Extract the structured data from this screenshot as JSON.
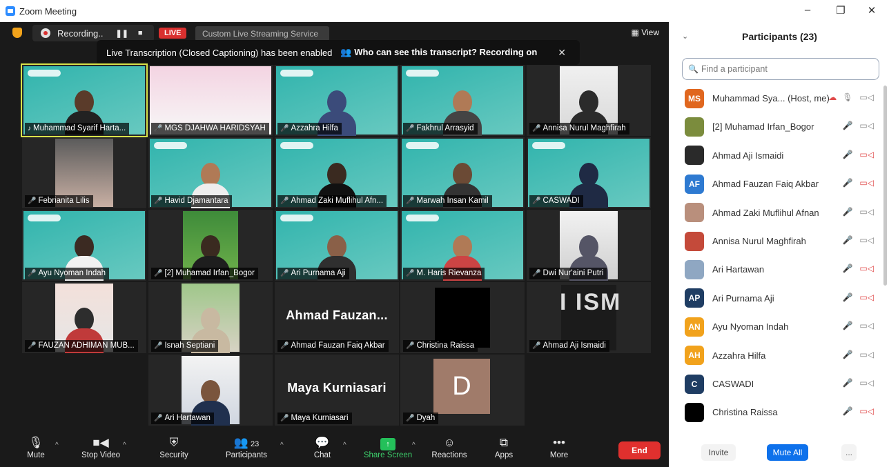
{
  "window": {
    "title": "Zoom Meeting"
  },
  "topbar": {
    "recording_label": "Recording..",
    "live_label": "LIVE",
    "stream_label": "Custom Live Streaming Service",
    "view_label": "View"
  },
  "caption_banner": {
    "text": "Live Transcription (Closed Captioning) has been enabled",
    "link": "Who can see this transcript? Recording on"
  },
  "tiles": [
    {
      "name": "Muhammad Syarif Harta..."
    },
    {
      "name": "MGS DJAHWA HARIDSYAH"
    },
    {
      "name": "Azzahra Hilfa"
    },
    {
      "name": "Fakhrul Arrasyid"
    },
    {
      "name": "Annisa Nurul Maghfirah"
    },
    {
      "name": "Febrianita Lilis"
    },
    {
      "name": "Havid Djamantara"
    },
    {
      "name": "Ahmad Zaki Muflihul Afn..."
    },
    {
      "name": "Marwah Insan Kamil"
    },
    {
      "name": "CASWADI"
    },
    {
      "name": "Ayu Nyoman Indah"
    },
    {
      "name": "[2] Muhamad Irfan_Bogor"
    },
    {
      "name": "Ari Purnama Aji"
    },
    {
      "name": "M. Haris Rievanza"
    },
    {
      "name": "Dwi Nur'aini Putri"
    },
    {
      "name": "FAUZAN ADHIMAN MUB..."
    },
    {
      "name": "Isnah Septiani"
    },
    {
      "name": "Ahmad Fauzan Faiq Akbar",
      "big": "Ahmad  Fauzan..."
    },
    {
      "name": "Christina Raissa"
    },
    {
      "name": "Ahmad Aji Ismaidi"
    },
    {
      "name": "Ari Hartawan"
    },
    {
      "name": "Maya Kurniasari",
      "big": "Maya Kurniasari"
    },
    {
      "name": "Dyah",
      "initial": "D"
    }
  ],
  "toolbar": {
    "mute": "Mute",
    "stop_video": "Stop Video",
    "security": "Security",
    "participants": "Participants",
    "participants_count": "23",
    "chat": "Chat",
    "share_screen": "Share Screen",
    "reactions": "Reactions",
    "apps": "Apps",
    "more": "More",
    "end": "End"
  },
  "panel": {
    "title": "Participants (23)",
    "search_placeholder": "Find a participant",
    "participants": [
      {
        "name": "Muhammad Sya... (Host, me)",
        "initials": "MS",
        "color": "#e0671f"
      },
      {
        "name": "[2] Muhamad Irfan_Bogor",
        "initials": "",
        "color": "#7b8c3d"
      },
      {
        "name": "Ahmad Aji Ismaidi",
        "initials": "",
        "color": "#2a2a2a"
      },
      {
        "name": "Ahmad Fauzan Faiq Akbar",
        "initials": "AF",
        "color": "#2e7ad1"
      },
      {
        "name": "Ahmad Zaki Muflihul Afnan",
        "initials": "",
        "color": "#b98f7c"
      },
      {
        "name": "Annisa Nurul Maghfirah",
        "initials": "",
        "color": "#c44a3a"
      },
      {
        "name": "Ari Hartawan",
        "initials": "",
        "color": "#8fa7c2"
      },
      {
        "name": "Ari Purnama Aji",
        "initials": "AP",
        "color": "#1f3d63"
      },
      {
        "name": "Ayu Nyoman Indah",
        "initials": "AN",
        "color": "#f1a21c"
      },
      {
        "name": "Azzahra Hilfa",
        "initials": "AH",
        "color": "#f1a21c"
      },
      {
        "name": "CASWADI",
        "initials": "C",
        "color": "#1f3d63"
      },
      {
        "name": "Christina Raissa",
        "initials": "",
        "color": "#000000"
      }
    ],
    "invite": "Invite",
    "mute_all": "Mute All",
    "more": "..."
  }
}
